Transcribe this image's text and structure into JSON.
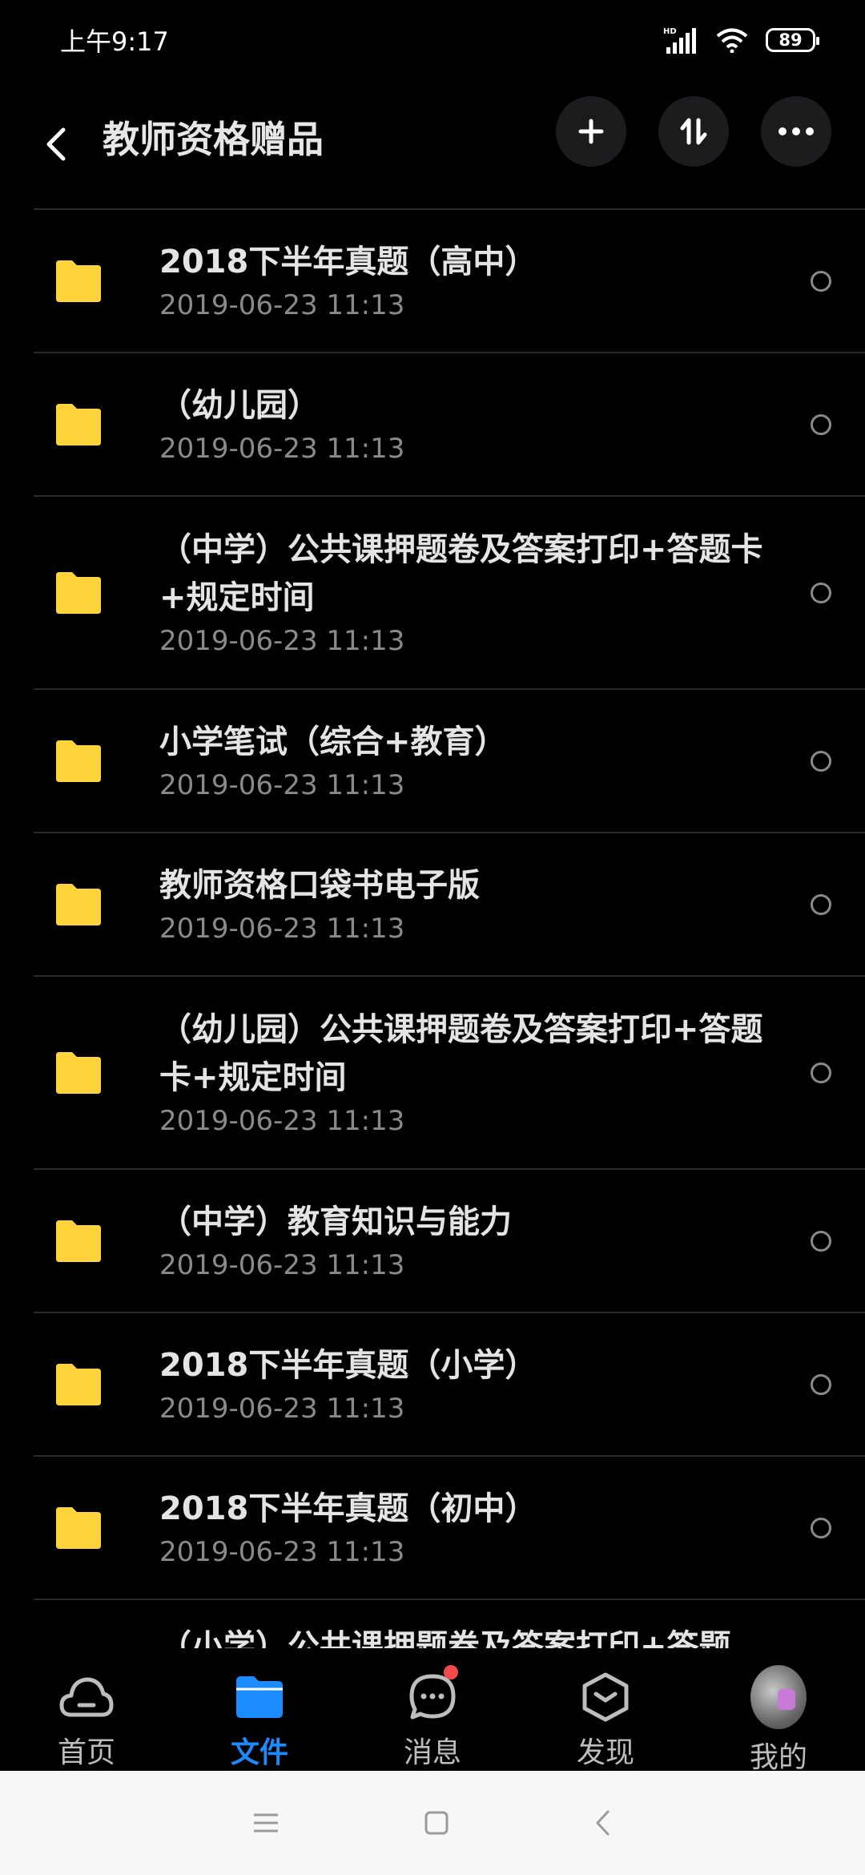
{
  "status": {
    "time": "上午9:17",
    "battery": "89",
    "network": "HD"
  },
  "header": {
    "title": "教师资格赠品"
  },
  "files": [
    {
      "name": "2018下半年真题（高中）",
      "date": "2019-06-23  11:13"
    },
    {
      "name": "（幼儿园）",
      "date": "2019-06-23  11:13"
    },
    {
      "name": "（中学）公共课押题卷及答案打印+答题卡+规定时间",
      "date": "2019-06-23  11:13"
    },
    {
      "name": "小学笔试（综合+教育）",
      "date": "2019-06-23  11:13"
    },
    {
      "name": "教师资格口袋书电子版",
      "date": "2019-06-23  11:13"
    },
    {
      "name": "（幼儿园）公共课押题卷及答案打印+答题卡+规定时间",
      "date": "2019-06-23  11:13"
    },
    {
      "name": "（中学）教育知识与能力",
      "date": "2019-06-23  11:13"
    },
    {
      "name": "2018下半年真题（小学）",
      "date": "2019-06-23  11:13"
    },
    {
      "name": "2018下半年真题（初中）",
      "date": "2019-06-23  11:13"
    },
    {
      "name": "（小学）公共课押题卷及答案打印+答题"
    }
  ],
  "tabs": [
    {
      "label": "首页",
      "icon": "cloud-icon"
    },
    {
      "label": "文件",
      "icon": "folder-icon"
    },
    {
      "label": "消息",
      "icon": "message-icon"
    },
    {
      "label": "发现",
      "icon": "discover-icon"
    },
    {
      "label": "我的",
      "icon": "avatar"
    }
  ],
  "colors": {
    "accent": "#1a8cff",
    "folder": "#ffd43b",
    "badge": "#f04a4a"
  }
}
